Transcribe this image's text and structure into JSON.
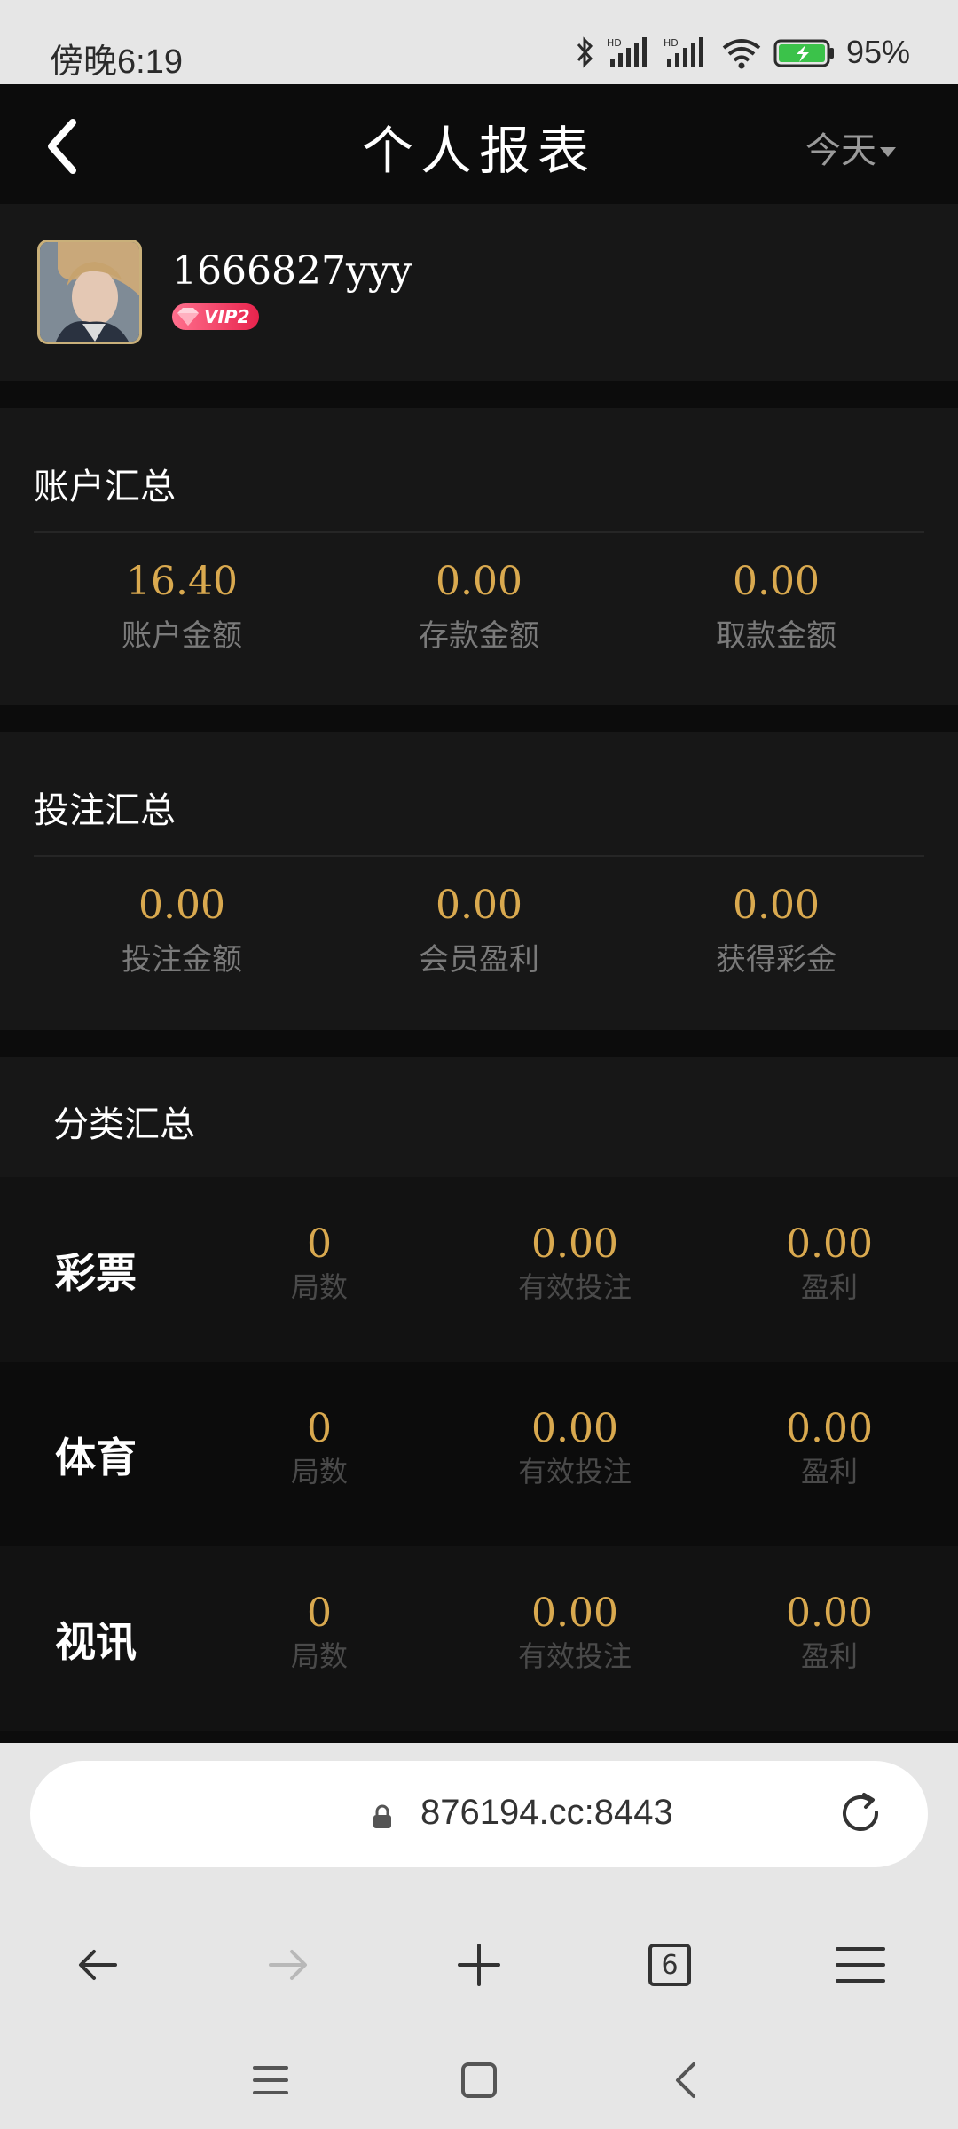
{
  "status_bar": {
    "time": "傍晚6:19",
    "battery": "95%",
    "icons": [
      "bluetooth-icon",
      "hd-signal-icon",
      "hd-signal-icon",
      "wifi-icon",
      "battery-charging-icon"
    ]
  },
  "nav": {
    "title": "个人报表",
    "filter": "今天",
    "back_icon": "chevron-left-icon"
  },
  "profile": {
    "username": "1666827yyy",
    "vip": "VIP2"
  },
  "account_summary": {
    "title": "账户汇总",
    "stats": [
      {
        "value": "16.40",
        "label": "账户金额"
      },
      {
        "value": "0.00",
        "label": "存款金额"
      },
      {
        "value": "0.00",
        "label": "取款金额"
      }
    ]
  },
  "bet_summary": {
    "title": "投注汇总",
    "stats": [
      {
        "value": "0.00",
        "label": "投注金额"
      },
      {
        "value": "0.00",
        "label": "会员盈利"
      },
      {
        "value": "0.00",
        "label": "获得彩金"
      }
    ]
  },
  "category_summary": {
    "title": "分类汇总",
    "rows": [
      {
        "name": "彩票",
        "rounds": "0",
        "rounds_label": "局数",
        "valid_bet": "0.00",
        "valid_bet_label": "有效投注",
        "profit": "0.00",
        "profit_label": "盈利"
      },
      {
        "name": "体育",
        "rounds": "0",
        "rounds_label": "局数",
        "valid_bet": "0.00",
        "valid_bet_label": "有效投注",
        "profit": "0.00",
        "profit_label": "盈利"
      },
      {
        "name": "视讯",
        "rounds": "0",
        "rounds_label": "局数",
        "valid_bet": "0.00",
        "valid_bet_label": "有效投注",
        "profit": "0.00",
        "profit_label": "盈利"
      }
    ]
  },
  "browser": {
    "url": "876194.cc:8443",
    "tab_count": "6"
  },
  "colors": {
    "accent_gold": "#d9a94f",
    "background": "#0c0c0c",
    "card": "#171717"
  }
}
